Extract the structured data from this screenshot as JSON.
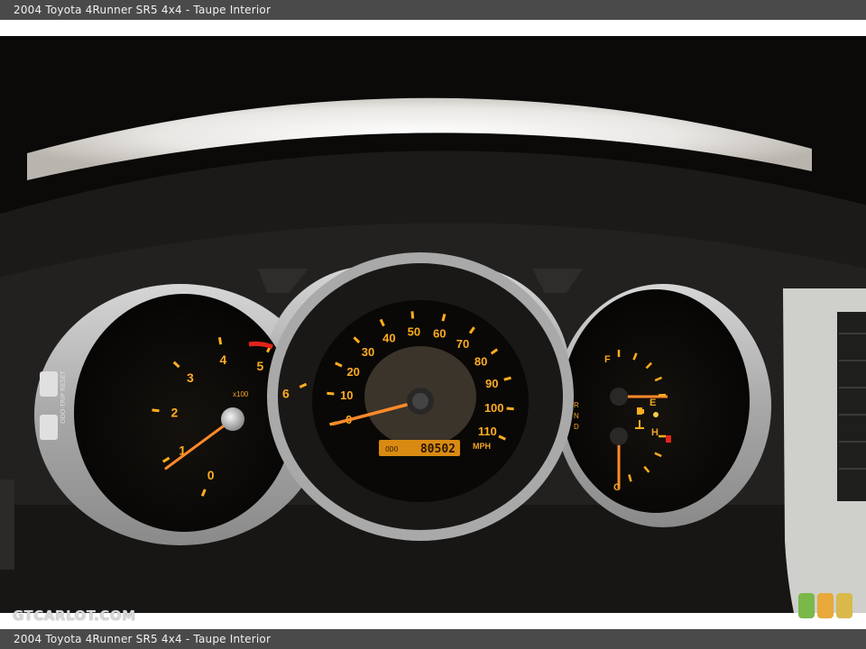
{
  "header": {
    "title": "2004 Toyota 4Runner SR5 4x4 - Taupe Interior"
  },
  "footer": {
    "caption": "2004 Toyota 4Runner SR5 4x4 - Taupe Interior"
  },
  "watermark": {
    "text": "GTCARLOT.COM",
    "swatch_colors": [
      "#7ab84a",
      "#e8a93a",
      "#d8b94a"
    ]
  },
  "photo": {
    "tachometer": {
      "ticks": [
        "0",
        "1",
        "2",
        "3",
        "4",
        "5",
        "6"
      ],
      "unit": "x100",
      "needle_value": 0.85
    },
    "speedometer": {
      "ticks": [
        "0",
        "10",
        "20",
        "30",
        "40",
        "50",
        "60",
        "70",
        "80",
        "90",
        "100",
        "110"
      ],
      "unit": "MPH",
      "odometer_label": "ODO",
      "odometer": "80502",
      "needle_value_mph": 0
    },
    "fuel_gauge": {
      "full_label": "F",
      "empty_label": "E",
      "level": 0.35
    },
    "temp_gauge": {
      "hot_label": "H",
      "cold_label": "C",
      "level": 0.0
    },
    "trip_button_label": "ODO-TRIP RESET",
    "shift_indicator": [
      "R",
      "N",
      "D"
    ],
    "colors": {
      "gauge_orange": "#ffad1f",
      "needle": "#ff8a2a",
      "bezel": "#b9b9b9",
      "dash": "#1d1c1b"
    }
  }
}
